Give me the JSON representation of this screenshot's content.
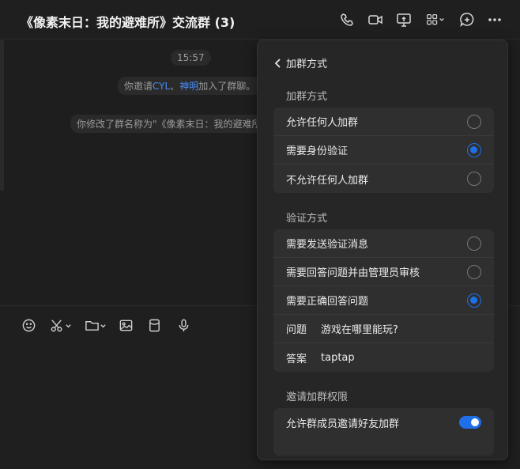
{
  "header": {
    "title": "《像素末日：我的避难所》交流群 (3)",
    "icons": [
      "phone-icon",
      "video-icon",
      "screen-share-icon",
      "apps-icon",
      "add-icon",
      "more-icon"
    ]
  },
  "chat": {
    "time": "15:57",
    "invite_prefix": "你邀请",
    "invite_user1": "CYL",
    "invite_sep": "、",
    "invite_user2": "神明",
    "invite_suffix": "加入了群聊。",
    "rename_text": "你修改了群名称为\"《像素末日：我的避难所"
  },
  "panel": {
    "back_label": "加群方式",
    "join_section": "加群方式",
    "join_options": [
      {
        "label": "允许任何人加群",
        "selected": false
      },
      {
        "label": "需要身份验证",
        "selected": true
      },
      {
        "label": "不允许任何人加群",
        "selected": false
      }
    ],
    "verify_section": "验证方式",
    "verify_options": [
      {
        "label": "需要发送验证消息",
        "selected": false
      },
      {
        "label": "需要回答问题并由管理员审核",
        "selected": false
      },
      {
        "label": "需要正确回答问题",
        "selected": true
      }
    ],
    "question_label": "问题",
    "question_value": "游戏在哪里能玩?",
    "answer_label": "答案",
    "answer_value": "taptap",
    "invite_section": "邀请加群权限",
    "invite_toggle_label": "允许群成员邀请好友加群",
    "invite_toggle_on": true
  },
  "colors": {
    "accent": "#1e6fe8",
    "link": "#4a8df8"
  }
}
